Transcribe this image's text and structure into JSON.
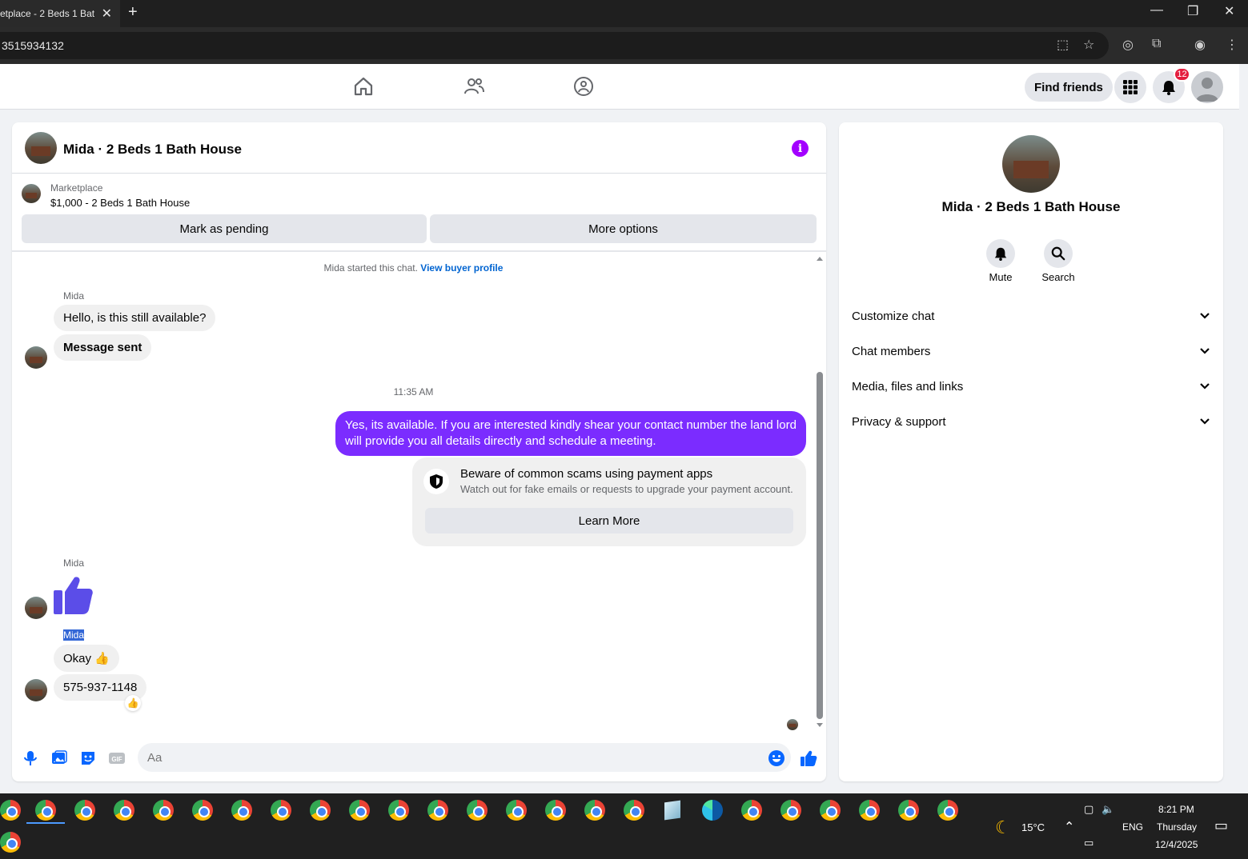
{
  "browser": {
    "tab_title": "etplace - 2 Beds 1 Bat",
    "tab_close": "✕",
    "new_tab": "+",
    "url": "3515934132"
  },
  "nav": {
    "find_friends": "Find friends",
    "notification_count": "12"
  },
  "chat": {
    "title": "Mida · 2 Beds 1 Bath House",
    "marketplace_label": "Marketplace",
    "listing": "$1,000 - 2 Beds 1 Bath House",
    "mark_pending": "Mark as pending",
    "more_options": "More options",
    "started_text": "Mida started this chat.",
    "view_profile": "View buyer profile",
    "sender_name": "Mida",
    "msg1": "Hello, is this still available?",
    "msg2": "Message sent",
    "timestamp": "11:35 AM",
    "outgoing": "Yes, its available. If you are interested kindly shear your contact number the land lord will provide you all details directly and schedule a meeting.",
    "scam_title": "Beware of common scams using payment apps",
    "scam_desc": "Watch out for fake emails or requests to upgrade your payment account.",
    "learn_more": "Learn More",
    "msg3": "Okay 👍",
    "msg4": "575-937-1148",
    "input_placeholder": "Aa"
  },
  "side": {
    "name": "Mida · 2 Beds 1 Bath House",
    "mute": "Mute",
    "search": "Search",
    "sections": [
      "Customize chat",
      "Chat members",
      "Media, files and links",
      "Privacy & support"
    ]
  },
  "taskbar": {
    "weather": "15°C",
    "lang": "ENG",
    "time": "8:21 PM",
    "day": "Thursday",
    "date": "12/4/2025"
  },
  "colors": {
    "accent": "#7b2cff",
    "info": "#a300ff",
    "link": "#0064d1",
    "like": "#0866ff"
  }
}
